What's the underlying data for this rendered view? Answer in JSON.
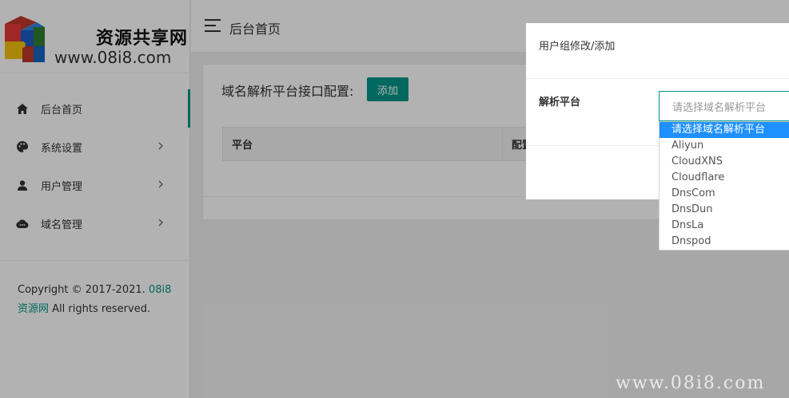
{
  "logo": {
    "name_cn": "资源共享网",
    "url": "www.08i8.com"
  },
  "header": {
    "title": "后台首页"
  },
  "sidebar": {
    "items": [
      {
        "label": "后台首页",
        "icon": "home-icon"
      },
      {
        "label": "系统设置",
        "icon": "palette-icon"
      },
      {
        "label": "用户管理",
        "icon": "user-icon"
      },
      {
        "label": "域名管理",
        "icon": "cloud-icon"
      }
    ],
    "copyright": {
      "prefix": "Copyright © 2017-2021.",
      "link": "08i8资源网",
      "suffix": "All rights reserved."
    }
  },
  "main": {
    "title": "域名解析平台接口配置:",
    "add_label": "添加",
    "table": {
      "columns": [
        "平台",
        "配置"
      ]
    }
  },
  "modal": {
    "title": "用户组修改/添加",
    "field_label": "解析平台",
    "select_placeholder": "请选择域名解析平台",
    "options": [
      "请选择域名解析平台",
      "Aliyun",
      "CloudXNS",
      "Cloudflare",
      "DnsCom",
      "DnsDun",
      "DnsLa",
      "Dnspod"
    ]
  },
  "watermark": "www.08i8.com",
  "colors": {
    "accent": "#009688",
    "selected_option": "#1e90ff"
  }
}
